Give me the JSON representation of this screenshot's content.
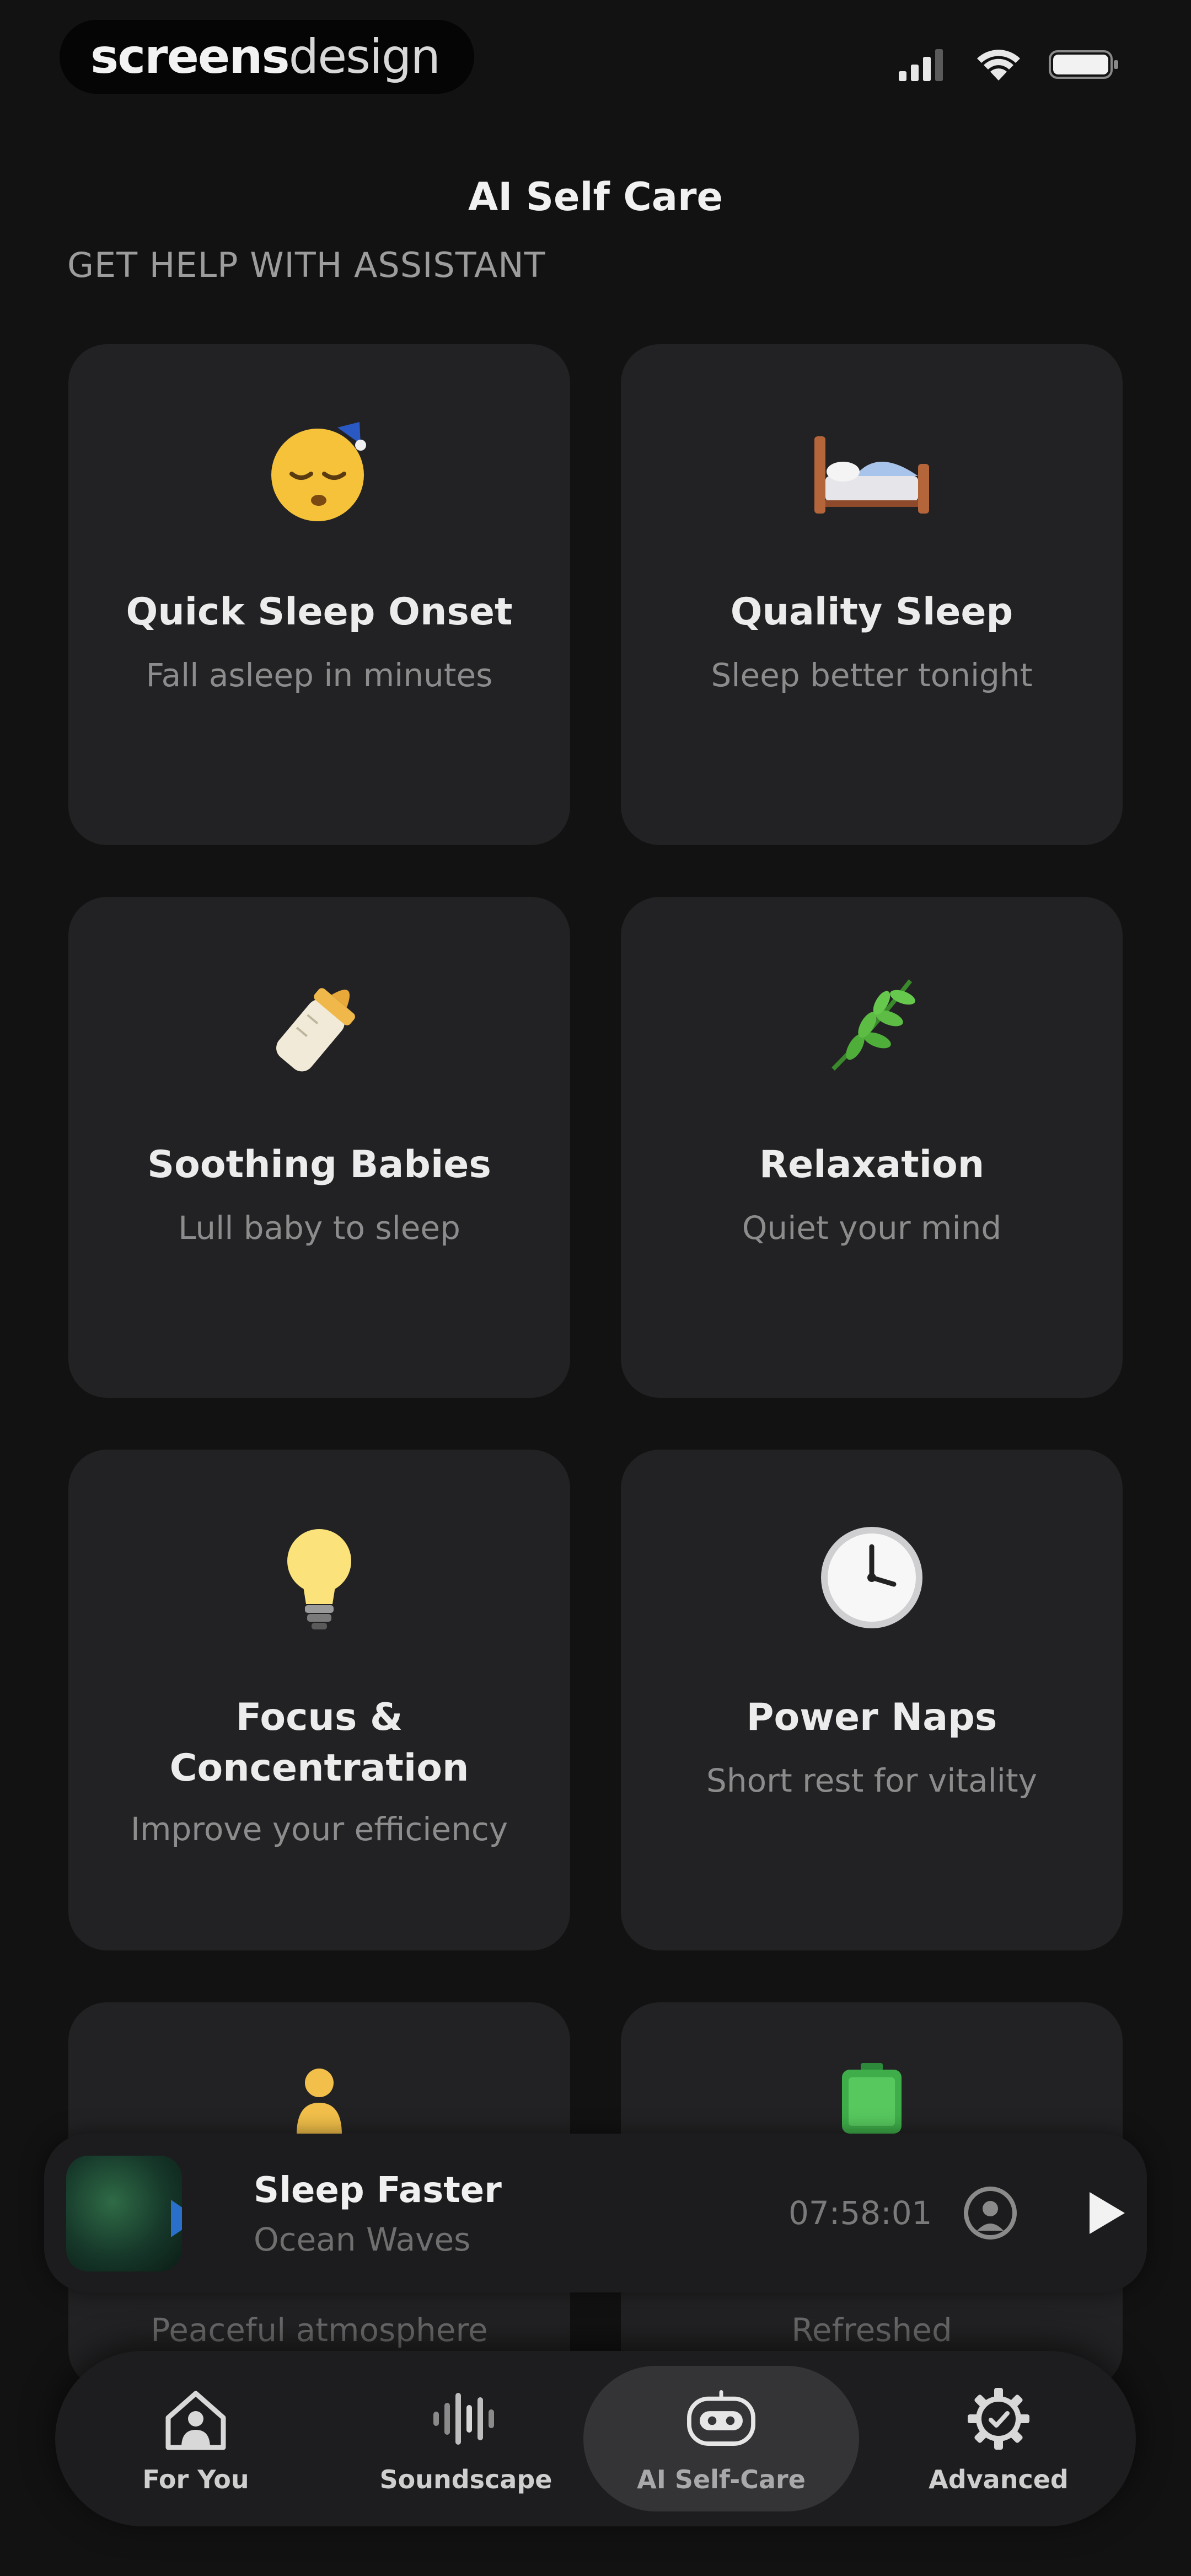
{
  "status_bar": {
    "brand_bold": "screens",
    "brand_light": "design",
    "icons": [
      "signal-icon",
      "wifi-icon",
      "battery-icon"
    ]
  },
  "header": {
    "title": "AI Self Care",
    "section_label": "GET HELP WITH ASSISTANT"
  },
  "cards": [
    {
      "emoji": "sleeping-face-icon",
      "title": "Quick Sleep Onset",
      "subtitle": "Fall asleep in minutes"
    },
    {
      "emoji": "bed-icon",
      "title": "Quality Sleep",
      "subtitle": "Sleep better tonight"
    },
    {
      "emoji": "baby-bottle-icon",
      "title": "Soothing Babies",
      "subtitle": "Lull baby to sleep"
    },
    {
      "emoji": "herb-icon",
      "title": "Relaxation",
      "subtitle": "Quiet your mind"
    },
    {
      "emoji": "light-bulb-icon",
      "title": "Focus & Concentration",
      "subtitle": "Improve your efficiency"
    },
    {
      "emoji": "clock-icon",
      "title": "Power Naps",
      "subtitle": "Short rest for vitality"
    },
    {
      "emoji": "person-icon",
      "title": "",
      "subtitle": "Peaceful atmosphere"
    },
    {
      "emoji": "battery-full-icon",
      "title": "",
      "subtitle": "Refreshed"
    }
  ],
  "now_playing": {
    "title": "Sleep Faster",
    "subtitle": "Ocean Waves",
    "time": "07:58:01"
  },
  "tabs": [
    {
      "label": "For You",
      "icon": "home-person-icon",
      "active": false
    },
    {
      "label": "Soundscape",
      "icon": "waveform-icon",
      "active": false
    },
    {
      "label": "AI Self-Care",
      "icon": "robot-icon",
      "active": true
    },
    {
      "label": "Advanced",
      "icon": "gear-icon",
      "active": false
    }
  ],
  "colors": {
    "background": "#121212",
    "card": "#222224",
    "accent_blue": "#2a6fc9"
  }
}
